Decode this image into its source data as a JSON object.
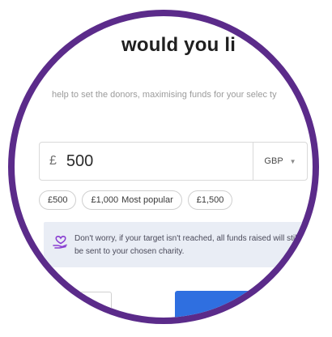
{
  "heading": "would you li",
  "subtext": "help to set the donors, maximising funds for your selec ty",
  "amount": {
    "currency_symbol": "£",
    "value": "500",
    "currency": "GBP"
  },
  "chips": [
    {
      "label": "£500"
    },
    {
      "label": "£1,000",
      "note": "Most popular"
    },
    {
      "label": "£1,500"
    }
  ],
  "info": {
    "icon": "heart-hand-icon",
    "text": "Don't worry, if your target isn't reached, all funds raised will still be sent to your chosen charity."
  },
  "colors": {
    "frame": "#5b2b8a",
    "primary_button": "#2f6fe0",
    "info_background": "#e9edf5",
    "info_icon": "#8a3fd1"
  }
}
